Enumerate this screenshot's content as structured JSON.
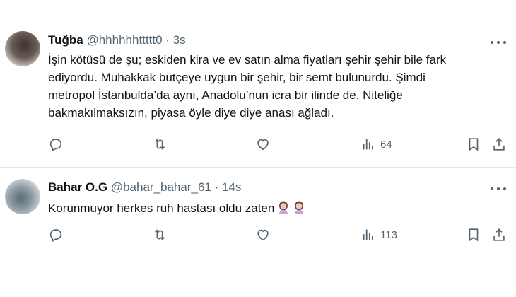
{
  "tweets": [
    {
      "name": "Tuğba",
      "handle": "@hhhhhhttttt0",
      "separator": "·",
      "time": "3s",
      "text": "İşin kötüsü de şu; eskiden kira ve ev satın alma fiyatları şehir şehir bile fark\nediyordu. Muhakkak bütçeye uygun bir şehir, bir semt bulunurdu. Şimdi\nmetropol İstanbulda’da aynı, Anadolu’nun icra bir ilinde de. Niteliğe\nbakmakılmaksızın, piyasa öyle diye diye anası ağladı.",
      "views": "64",
      "avatar_icon": "profile-photo"
    },
    {
      "name": "Bahar O.G",
      "handle": "@bahar_bahar_61",
      "separator": "·",
      "time": "14s",
      "text": "Korunmuyor herkes ruh hastası oldu zaten",
      "emojis": [
        "woman-facepalming",
        "woman-facepalming"
      ],
      "views": "113",
      "avatar_icon": "profile-photo"
    }
  ],
  "icons": {
    "reply": "reply-icon",
    "retweet": "retweet-icon",
    "like": "heart-icon",
    "views": "views-chart-icon",
    "bookmark": "bookmark-icon",
    "share": "share-icon",
    "more": "more-dots-icon"
  },
  "colors": {
    "text": "#0f1419",
    "secondary": "#536471",
    "divider": "#e1e6ea"
  }
}
